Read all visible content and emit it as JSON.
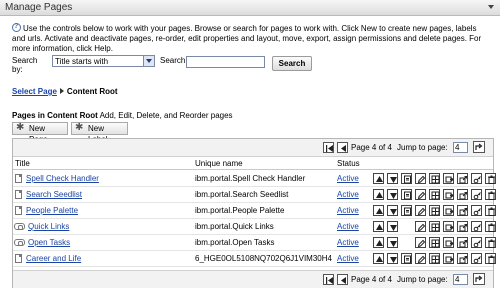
{
  "header": {
    "title": "Manage Pages"
  },
  "intro": {
    "text": "Use the controls below to work with your pages. Browse or search for pages to work with. Click New to create new pages, labels and urls. Activate and deactivate pages, re-order, edit properties and layout, move, export, assign permissions and delete pages. For more information, click Help."
  },
  "search": {
    "by_label": "Search by:",
    "by_value": "Title starts with",
    "search_label": "Search:",
    "query": "",
    "button": "Search"
  },
  "breadcrumb": {
    "link": "Select Page",
    "current": "Content Root"
  },
  "section": {
    "title": "Pages in Content Root",
    "hint": "Add, Edit, Delete, and Reorder pages"
  },
  "toolbar": {
    "new_page": "New Page",
    "new_label": "New Label"
  },
  "pager": {
    "text": "Page 4 of 4",
    "jump_label": "Jump to page:",
    "jump_value": "4"
  },
  "table": {
    "columns": {
      "title": "Title",
      "unique": "Unique name",
      "status": "Status"
    },
    "rows": [
      {
        "title": "Spell Check Handler",
        "unique": "ibm.portal.Spell Check Handler",
        "status": "Active",
        "icon": "page-icon"
      },
      {
        "title": "Search Seedlist",
        "unique": "ibm.portal.Search Seedlist",
        "status": "Active",
        "icon": "page-icon"
      },
      {
        "title": "People Palette",
        "unique": "ibm.portal.People Palette",
        "status": "Active",
        "icon": "page-icon"
      },
      {
        "title": "Quick Links",
        "unique": "ibm.portal.Quick Links",
        "status": "Active",
        "icon": "label-icon"
      },
      {
        "title": "Open Tasks",
        "unique": "ibm.portal.Open Tasks",
        "status": "Active",
        "icon": "label-icon"
      },
      {
        "title": "Career and Life",
        "unique": "6_HGE0OL5108NQ702Q6J1VIM30H4",
        "status": "Active",
        "icon": "page-icon"
      }
    ]
  },
  "colors": {
    "link": "#1a44a5",
    "header_bg": "#dcdcdc"
  }
}
